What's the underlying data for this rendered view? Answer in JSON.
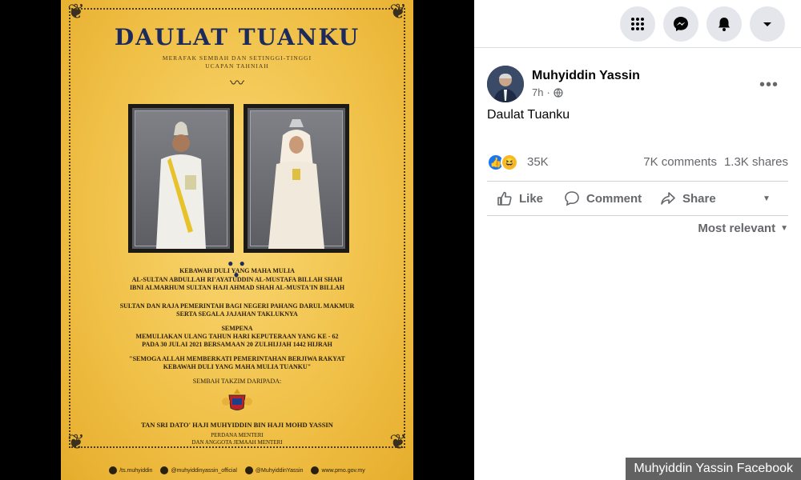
{
  "poster": {
    "title": "DAULAT TUANKU",
    "subtitle_1": "MERAFAK SEMBAH DAN SETINGGI-TINGGI",
    "subtitle_2": "UCAPAN TAHNIAH",
    "line_1": "KEBAWAH DULI YANG MAHA MULIA",
    "line_2": "AL-SULTAN ABDULLAH RI'AYATUDDIN AL-MUSTAFA BILLAH SHAH",
    "line_3": "IBNI ALMARHUM SULTAN HAJI AHMAD SHAH AL-MUSTA'IN BILLAH",
    "line_4": "SULTAN DAN RAJA PEMERINTAH BAGI NEGERI PAHANG DARUL MAKMUR",
    "line_5": "SERTA SEGALA JAJAHAN TAKLUKNYA",
    "line_6": "SEMPENA",
    "line_7": "MEMULIAKAN ULANG TAHUN HARI KEPUTERAAN YANG KE - 62",
    "line_8": "PADA 30 JULAI 2021 BERSAMAAN 20 ZULHIJJAH 1442 HIJRAH",
    "line_9": "\"SEMOGA ALLAH MEMBERKATI PEMERINTAHAN BERJIWA RAKYAT",
    "line_10": "KEBAWAH DULI YANG MAHA MULIA TUANKU\"",
    "line_11": "SEMBAH TAKZIM DARIPADA:",
    "signer": "TAN SRI DATO' HAJI MUHYIDDIN BIN HAJI MOHD YASSIN",
    "signer_title_1": "PERDANA MENTERI",
    "signer_title_2": "DAN ANGGOTA JEMAAH MENTERI",
    "footer": {
      "facebook": "/ts.muhyiddin",
      "instagram": "@muhyiddinyassin_official",
      "twitter": "@MuhyiddinYassin",
      "web": "www.pmo.gov.my"
    }
  },
  "post": {
    "author": "Muhyiddin Yassin",
    "time": "7h",
    "separator": "·",
    "text": "Daulat Tuanku",
    "reaction_count": "35K",
    "comments": "7K comments",
    "shares": "1.3K shares",
    "actions": {
      "like": "Like",
      "comment": "Comment",
      "share": "Share"
    },
    "sort_label": "Most relevant"
  },
  "caption": "Muhyiddin Yassin Facebook",
  "icons": {
    "menu": "grid-icon",
    "messenger": "messenger-icon",
    "notifications": "bell-icon",
    "account": "caret-down-icon"
  },
  "colors": {
    "poster_gold": "#f1c24a",
    "title_navy": "#1d2a5c",
    "fb_blue": "#1877f2",
    "fb_gray_text": "#65676b"
  }
}
